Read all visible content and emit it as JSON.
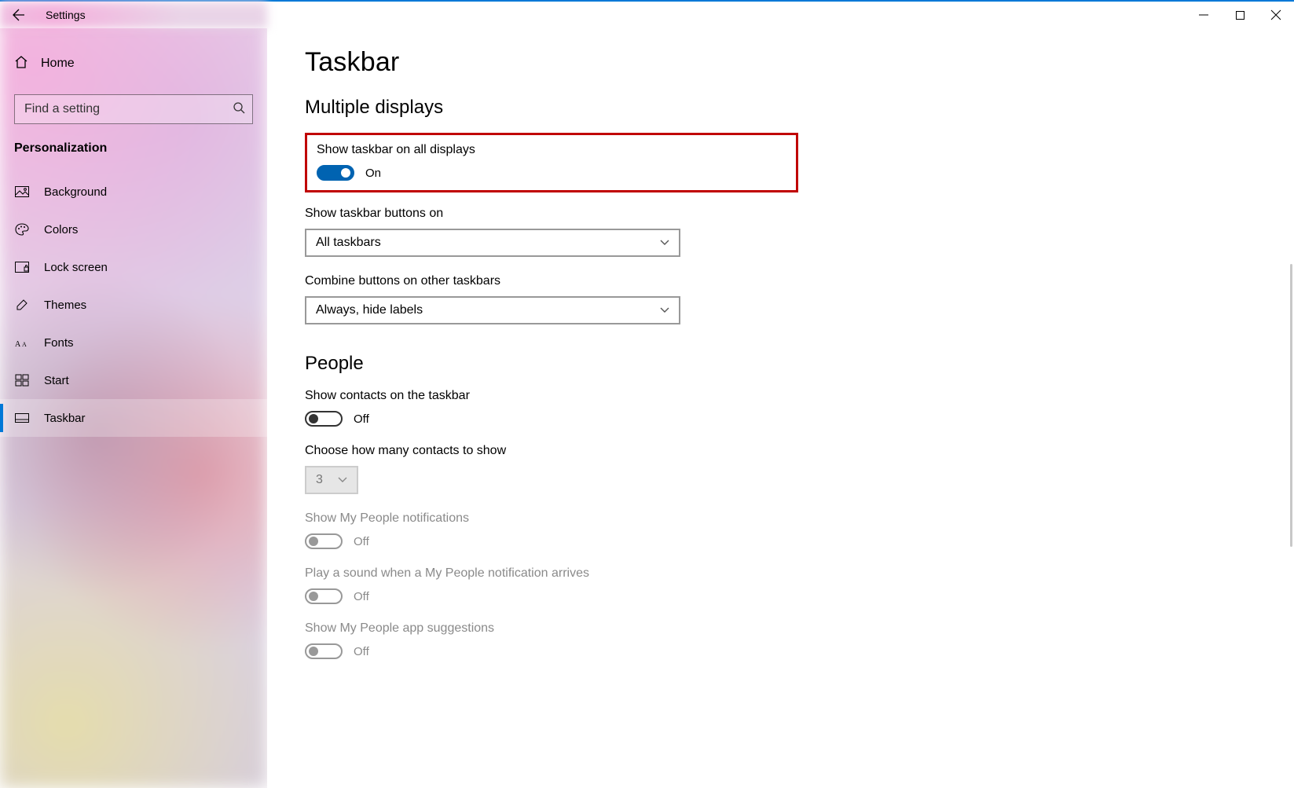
{
  "window": {
    "title": "Settings"
  },
  "sidebar": {
    "home": "Home",
    "search_placeholder": "Find a setting",
    "section": "Personalization",
    "items": [
      {
        "label": "Background"
      },
      {
        "label": "Colors"
      },
      {
        "label": "Lock screen"
      },
      {
        "label": "Themes"
      },
      {
        "label": "Fonts"
      },
      {
        "label": "Start"
      },
      {
        "label": "Taskbar"
      }
    ]
  },
  "page": {
    "title": "Taskbar",
    "sections": {
      "multi": {
        "heading": "Multiple displays",
        "show_all": {
          "label": "Show taskbar on all displays",
          "state": "On"
        },
        "buttons_on": {
          "label": "Show taskbar buttons on",
          "value": "All taskbars"
        },
        "combine": {
          "label": "Combine buttons on other taskbars",
          "value": "Always, hide labels"
        }
      },
      "people": {
        "heading": "People",
        "contacts": {
          "label": "Show contacts on the taskbar",
          "state": "Off"
        },
        "count": {
          "label": "Choose how many contacts to show",
          "value": "3"
        },
        "notifications": {
          "label": "Show My People notifications",
          "state": "Off"
        },
        "sound": {
          "label": "Play a sound when a My People notification arrives",
          "state": "Off"
        },
        "suggestions": {
          "label": "Show My People app suggestions",
          "state": "Off"
        }
      }
    }
  }
}
